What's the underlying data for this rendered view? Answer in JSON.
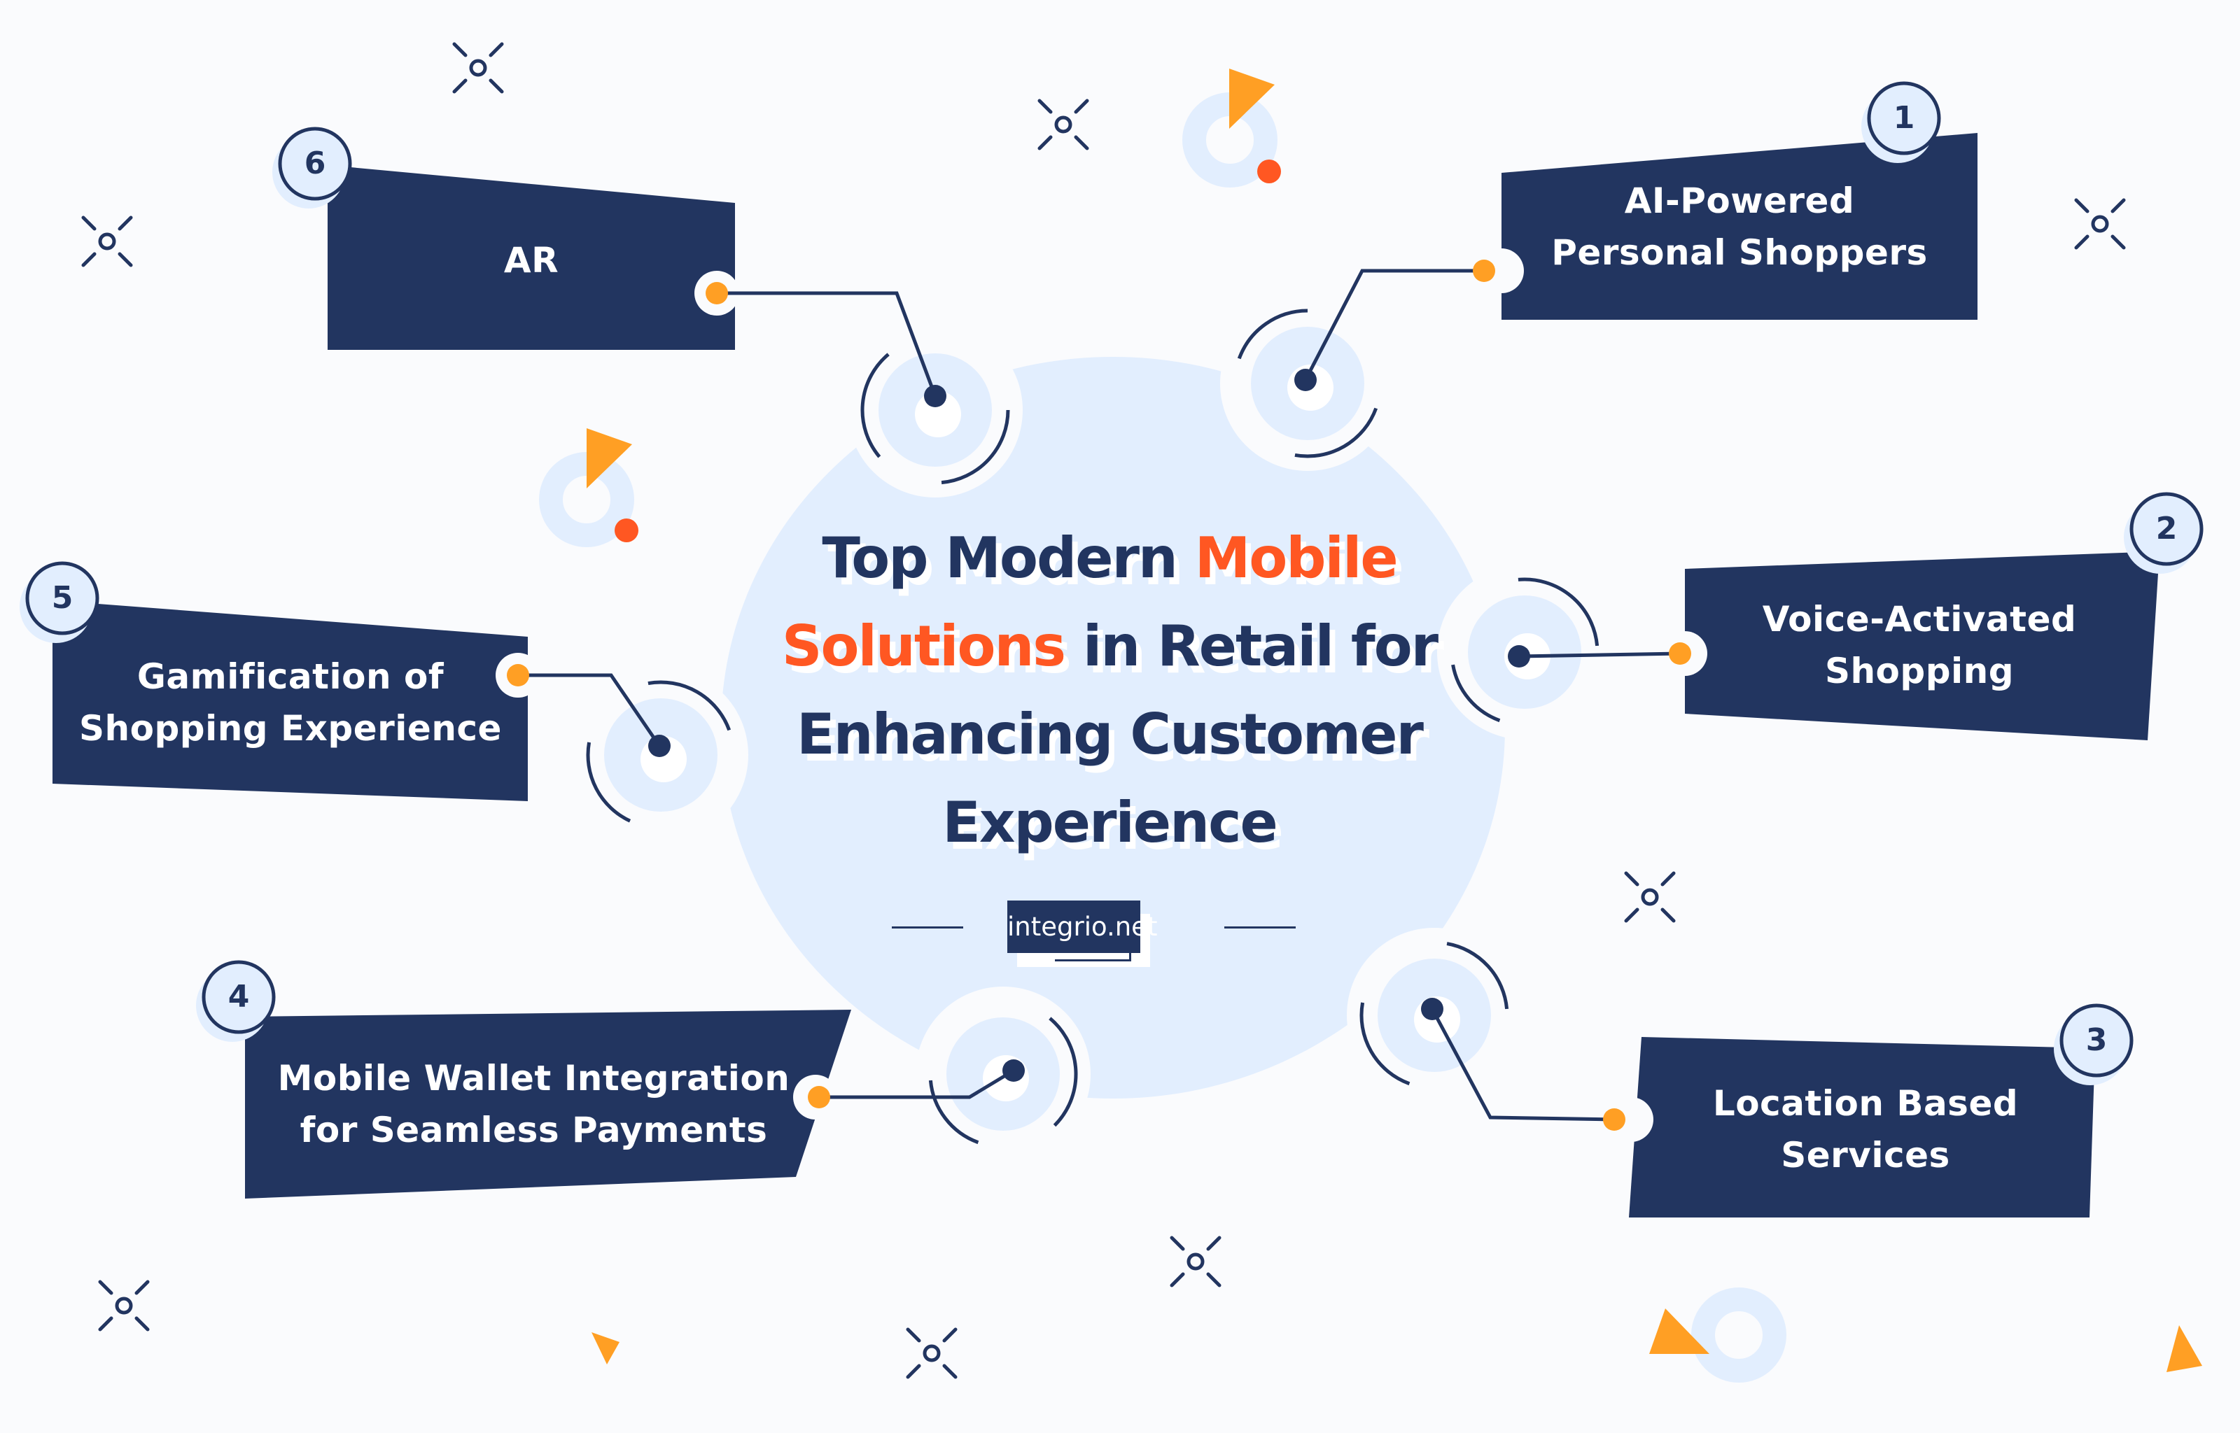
{
  "title": {
    "line1_dark": "Top Modern ",
    "line1_accent": "Mobile",
    "line2_accent": "Solutions",
    "line2_dark": " in Retail for",
    "line3": "Enhancing Customer",
    "line4": "Experience"
  },
  "brand": {
    "label": "integrio.net"
  },
  "items": [
    {
      "number": "1",
      "label_line1": "AI-Powered",
      "label_line2": "Personal Shoppers"
    },
    {
      "number": "2",
      "label_line1": "Voice-Activated",
      "label_line2": "Shopping"
    },
    {
      "number": "3",
      "label_line1": "Location Based",
      "label_line2": "Services"
    },
    {
      "number": "4",
      "label_line1": "Mobile Wallet Integration",
      "label_line2": "for Seamless Payments"
    },
    {
      "number": "5",
      "label_line1": "Gamification of",
      "label_line2": "Shopping Experience"
    },
    {
      "number": "6",
      "label_line1": "AR",
      "label_line2": ""
    }
  ],
  "colors": {
    "navy": "#223560",
    "accent_red": "#ff5722",
    "accent_orange": "#ff9f24",
    "light_blue": "#e2eefe",
    "background": "#fafbfd"
  }
}
